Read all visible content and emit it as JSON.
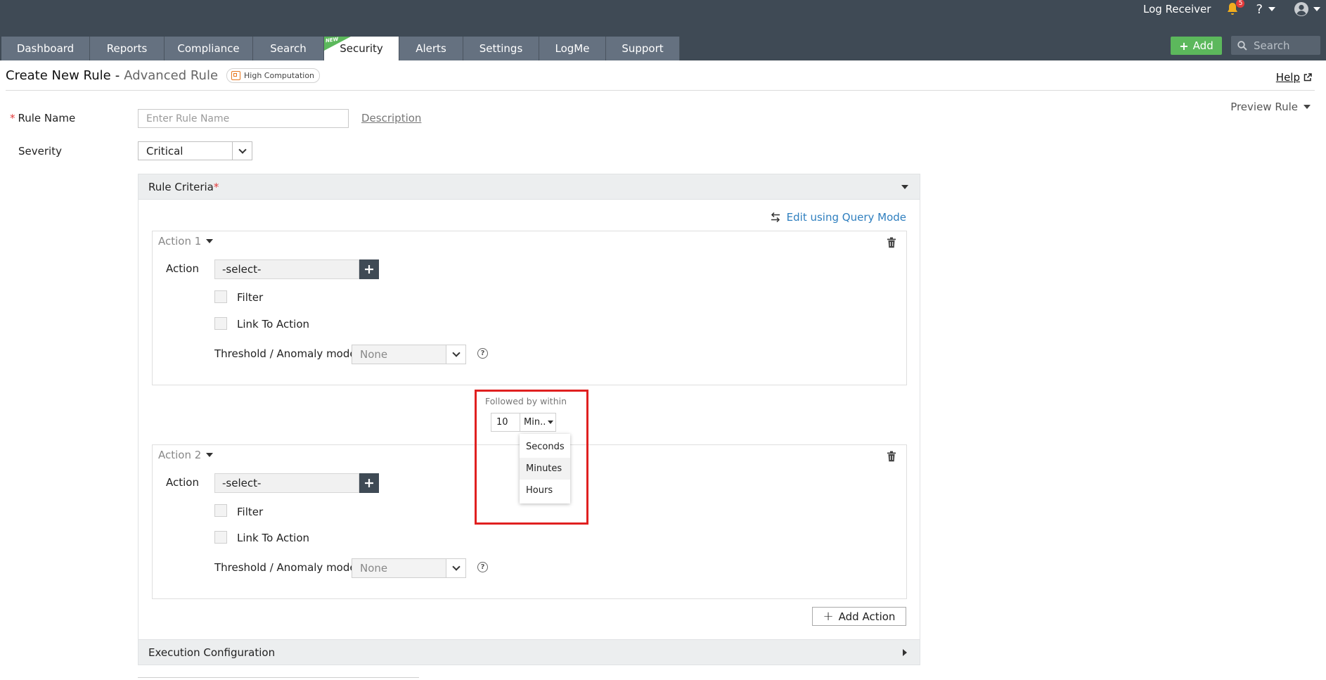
{
  "header": {
    "log_receiver": "Log Receiver",
    "notification_count": "5",
    "help_icon_text": "?",
    "add_label": "Add",
    "search_placeholder": "Search",
    "tabs": [
      {
        "label": "Dashboard"
      },
      {
        "label": "Reports"
      },
      {
        "label": "Compliance"
      },
      {
        "label": "Search"
      },
      {
        "label": "Security",
        "badge": "NEW",
        "active": true
      },
      {
        "label": "Alerts"
      },
      {
        "label": "Settings"
      },
      {
        "label": "LogMe"
      },
      {
        "label": "Support"
      }
    ]
  },
  "page": {
    "title": "Create New Rule",
    "separator": "-",
    "subtitle": "Advanced Rule",
    "badge": "High Computation",
    "help_label": "Help",
    "preview_label": "Preview Rule"
  },
  "form": {
    "rule_name_label": "Rule Name",
    "rule_name_placeholder": "Enter Rule Name",
    "rule_name_value": "",
    "description_link": "Description",
    "severity_label": "Severity",
    "severity_value": "Critical"
  },
  "criteria": {
    "title": "Rule Criteria",
    "required_mark": "*",
    "query_mode_label": "Edit using Query Mode",
    "actions": [
      {
        "title": "Action 1",
        "action_label": "Action",
        "action_value": "-select-",
        "filter_label": "Filter",
        "link_label": "Link To Action",
        "threshold_label": "Threshold / Anomaly model",
        "threshold_value": "None"
      },
      {
        "title": "Action 2",
        "action_label": "Action",
        "action_value": "-select-",
        "filter_label": "Filter",
        "link_label": "Link To Action",
        "threshold_label": "Threshold / Anomaly model",
        "threshold_value": "None"
      }
    ],
    "followed_by": {
      "label": "Followed by within",
      "value": "10",
      "unit_display": "Min..",
      "options": [
        "Seconds",
        "Minutes",
        "Hours"
      ],
      "hovered": "Minutes"
    },
    "add_action_label": "Add Action"
  },
  "execution": {
    "title": "Execution Configuration"
  },
  "colors": {
    "header_bg": "#3f4a55",
    "tab_bg": "#657180",
    "accent_green": "#5cb85c",
    "link_blue": "#2f7fbf",
    "highlight_red": "#e02020"
  }
}
